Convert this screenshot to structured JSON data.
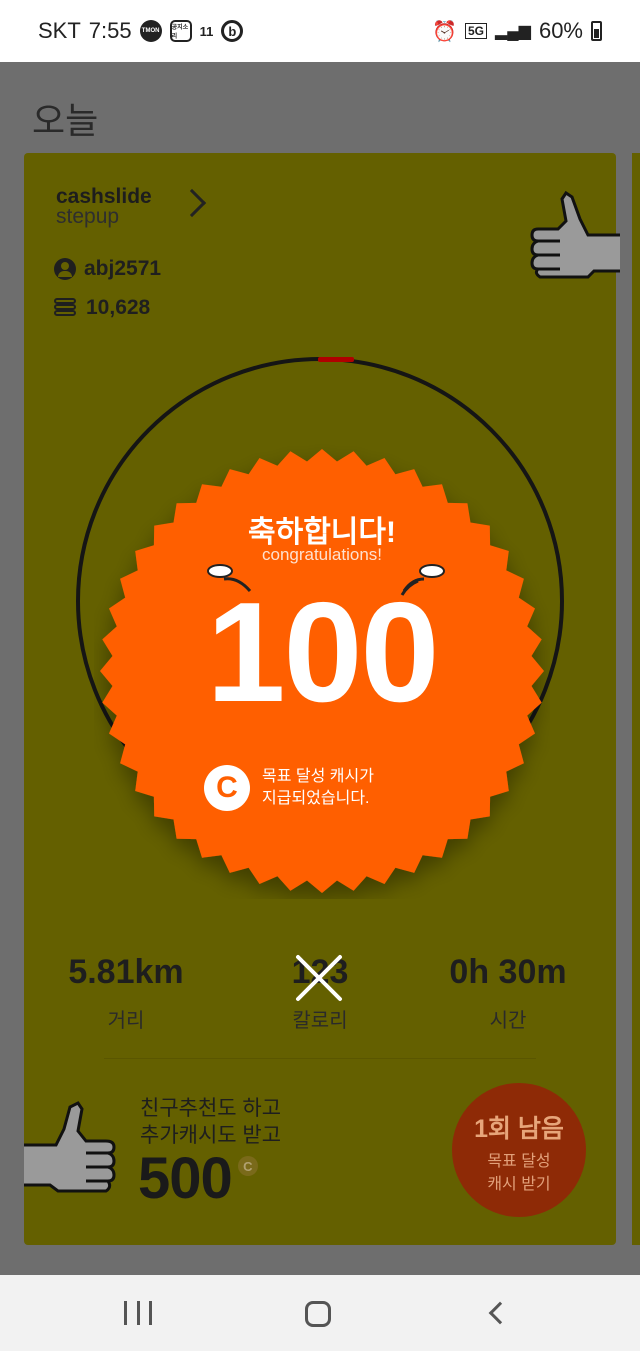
{
  "status_bar": {
    "carrier": "SKT",
    "time": "7:55",
    "app_icons": [
      "TMON",
      "공지소리",
      "11",
      "b"
    ],
    "network": "5G",
    "battery": "60%"
  },
  "page": {
    "title": "오늘"
  },
  "card": {
    "brand_line1": "cashslide",
    "brand_line2": "stepup",
    "username": "abj2571",
    "coins": "10,628",
    "progress_fraction": 1.0
  },
  "badge": {
    "title": "축하합니다!",
    "subtitle": "congratulations!",
    "value": "100",
    "c_symbol": "C",
    "message_line1": "목표 달성 캐시가",
    "message_line2": "지급되었습니다."
  },
  "stats": {
    "distance_value": "5.81km",
    "distance_label": "거리",
    "calorie_value": "123",
    "calorie_label": "칼로리",
    "time_value": "0h 30m",
    "time_label": "시간"
  },
  "promo": {
    "line1": "친구추천도 하고",
    "line2": "추가캐시도 받고",
    "amount": "500",
    "c_symbol": "C"
  },
  "goal_button": {
    "main": "1회 남음",
    "sub1": "목표 달성",
    "sub2": "캐시 받기"
  },
  "colors": {
    "card_bg": "#646000",
    "badge_orange": "#ff5f00",
    "ring_mark": "#b00000"
  }
}
